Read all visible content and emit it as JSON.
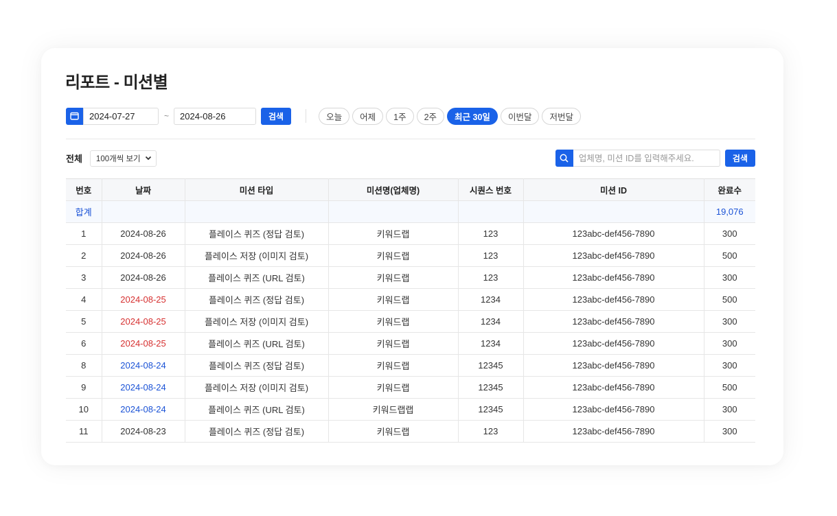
{
  "page": {
    "title": "리포트 - 미션별"
  },
  "filters": {
    "start_date": "2024-07-27",
    "separator": "~",
    "end_date": "2024-08-26",
    "search_label": "검색",
    "quick_ranges": [
      {
        "label": "오늘",
        "active": false
      },
      {
        "label": "어제",
        "active": false
      },
      {
        "label": "1주",
        "active": false
      },
      {
        "label": "2주",
        "active": false
      },
      {
        "label": "최근 30일",
        "active": true
      },
      {
        "label": "이번달",
        "active": false
      },
      {
        "label": "저번달",
        "active": false
      }
    ]
  },
  "toolbar": {
    "total_label": "전체",
    "page_size": "100개씩 보기",
    "search_placeholder": "업체명, 미션 ID를 입력해주세요.",
    "search_value": "",
    "search_label": "검색"
  },
  "colors": {
    "accent": "#1a62e8",
    "weekend_sunday": "#d63030",
    "weekend_saturday": "#1a52d6"
  },
  "table": {
    "headers": [
      "번호",
      "날짜",
      "미션 타입",
      "미션명(업체명)",
      "시퀀스 번호",
      "미션 ID",
      "완료수"
    ],
    "summary": {
      "label": "합계",
      "total": "19,076"
    },
    "rows": [
      {
        "no": "1",
        "date": "2024-08-26",
        "date_color": "default",
        "type": "플레이스 퀴즈 (정답 검토)",
        "name": "키워드랩",
        "seq": "123",
        "mission_id": "123abc-def456-7890",
        "count": "300"
      },
      {
        "no": "2",
        "date": "2024-08-26",
        "date_color": "default",
        "type": "플레이스 저장 (이미지 검토)",
        "name": "키워드랩",
        "seq": "123",
        "mission_id": "123abc-def456-7890",
        "count": "500"
      },
      {
        "no": "3",
        "date": "2024-08-26",
        "date_color": "default",
        "type": "플레이스 퀴즈 (URL 검토)",
        "name": "키워드랩",
        "seq": "123",
        "mission_id": "123abc-def456-7890",
        "count": "300"
      },
      {
        "no": "4",
        "date": "2024-08-25",
        "date_color": "red",
        "type": "플레이스 퀴즈 (정답 검토)",
        "name": "키워드랩",
        "seq": "1234",
        "mission_id": "123abc-def456-7890",
        "count": "500"
      },
      {
        "no": "5",
        "date": "2024-08-25",
        "date_color": "red",
        "type": "플레이스 저장 (이미지 검토)",
        "name": "키워드랩",
        "seq": "1234",
        "mission_id": "123abc-def456-7890",
        "count": "300"
      },
      {
        "no": "6",
        "date": "2024-08-25",
        "date_color": "red",
        "type": "플레이스 퀴즈 (URL 검토)",
        "name": "키워드랩",
        "seq": "1234",
        "mission_id": "123abc-def456-7890",
        "count": "300"
      },
      {
        "no": "8",
        "date": "2024-08-24",
        "date_color": "blue",
        "type": "플레이스 퀴즈 (정답 검토)",
        "name": "키워드랩",
        "seq": "12345",
        "mission_id": "123abc-def456-7890",
        "count": "300"
      },
      {
        "no": "9",
        "date": "2024-08-24",
        "date_color": "blue",
        "type": "플레이스 저장 (이미지 검토)",
        "name": "키워드랩",
        "seq": "12345",
        "mission_id": "123abc-def456-7890",
        "count": "500"
      },
      {
        "no": "10",
        "date": "2024-08-24",
        "date_color": "blue",
        "type": "플레이스 퀴즈 (URL 검토)",
        "name": "키워드랩랩",
        "seq": "12345",
        "mission_id": "123abc-def456-7890",
        "count": "300"
      },
      {
        "no": "11",
        "date": "2024-08-23",
        "date_color": "default",
        "type": "플레이스 퀴즈 (정답 검토)",
        "name": "키워드랩",
        "seq": "123",
        "mission_id": "123abc-def456-7890",
        "count": "300"
      }
    ]
  }
}
